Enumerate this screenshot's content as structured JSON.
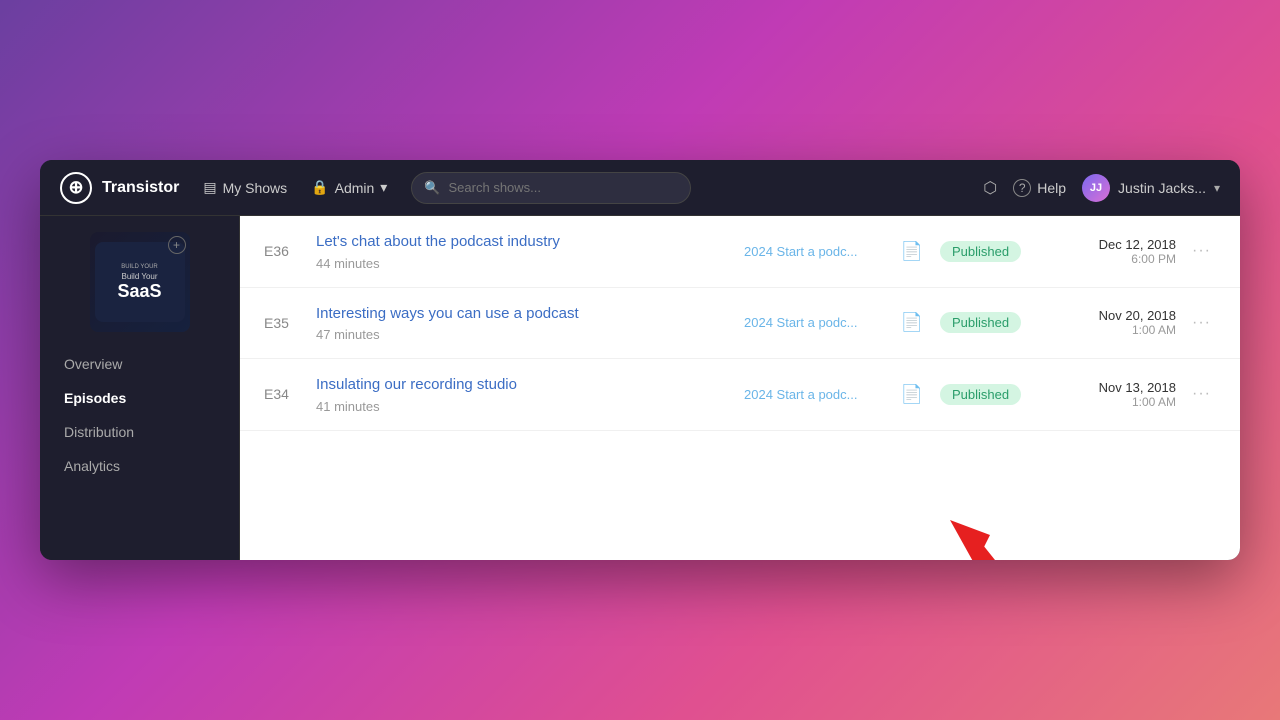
{
  "app": {
    "logo_symbol": "⊕",
    "logo_label": "Transistor",
    "nav": {
      "my_shows_icon": "▤",
      "my_shows_label": "My Shows",
      "admin_icon": "🔒",
      "admin_label": "Admin",
      "admin_caret": "▾",
      "search_placeholder": "Search shows...",
      "help_icon": "?",
      "help_label": "Help",
      "share_icon": "⬡",
      "user_name": "Justin Jacks...",
      "user_caret": "▾"
    },
    "sidebar": {
      "show_label_small": "BUILD YOUR",
      "show_label_big": "SaaS",
      "nav_items": [
        {
          "id": "overview",
          "label": "Overview",
          "active": false
        },
        {
          "id": "episodes",
          "label": "Episodes",
          "active": true
        },
        {
          "id": "distribution",
          "label": "Distribution",
          "active": false
        },
        {
          "id": "analytics",
          "label": "Analytics",
          "active": false
        }
      ]
    },
    "episodes": [
      {
        "id": "e36",
        "number": "E36",
        "title": "Let's chat about the podcast industry",
        "duration": "44 minutes",
        "show": "2024 Start a podc...",
        "doc_type": "green",
        "status": "Published",
        "date": "Dec 12, 2018",
        "time": "6:00 PM"
      },
      {
        "id": "e35",
        "number": "E35",
        "title": "Interesting ways you can use a podcast",
        "duration": "47 minutes",
        "show": "2024 Start a podc...",
        "doc_type": "green",
        "status": "Published",
        "date": "Nov 20, 2018",
        "time": "1:00 AM"
      },
      {
        "id": "e34",
        "number": "E34",
        "title": "Insulating our recording studio",
        "duration": "41 minutes",
        "show": "2024 Start a podc...",
        "doc_type": "gray",
        "status": "Published",
        "date": "Nov 13, 2018",
        "time": "1:00 AM"
      }
    ]
  }
}
